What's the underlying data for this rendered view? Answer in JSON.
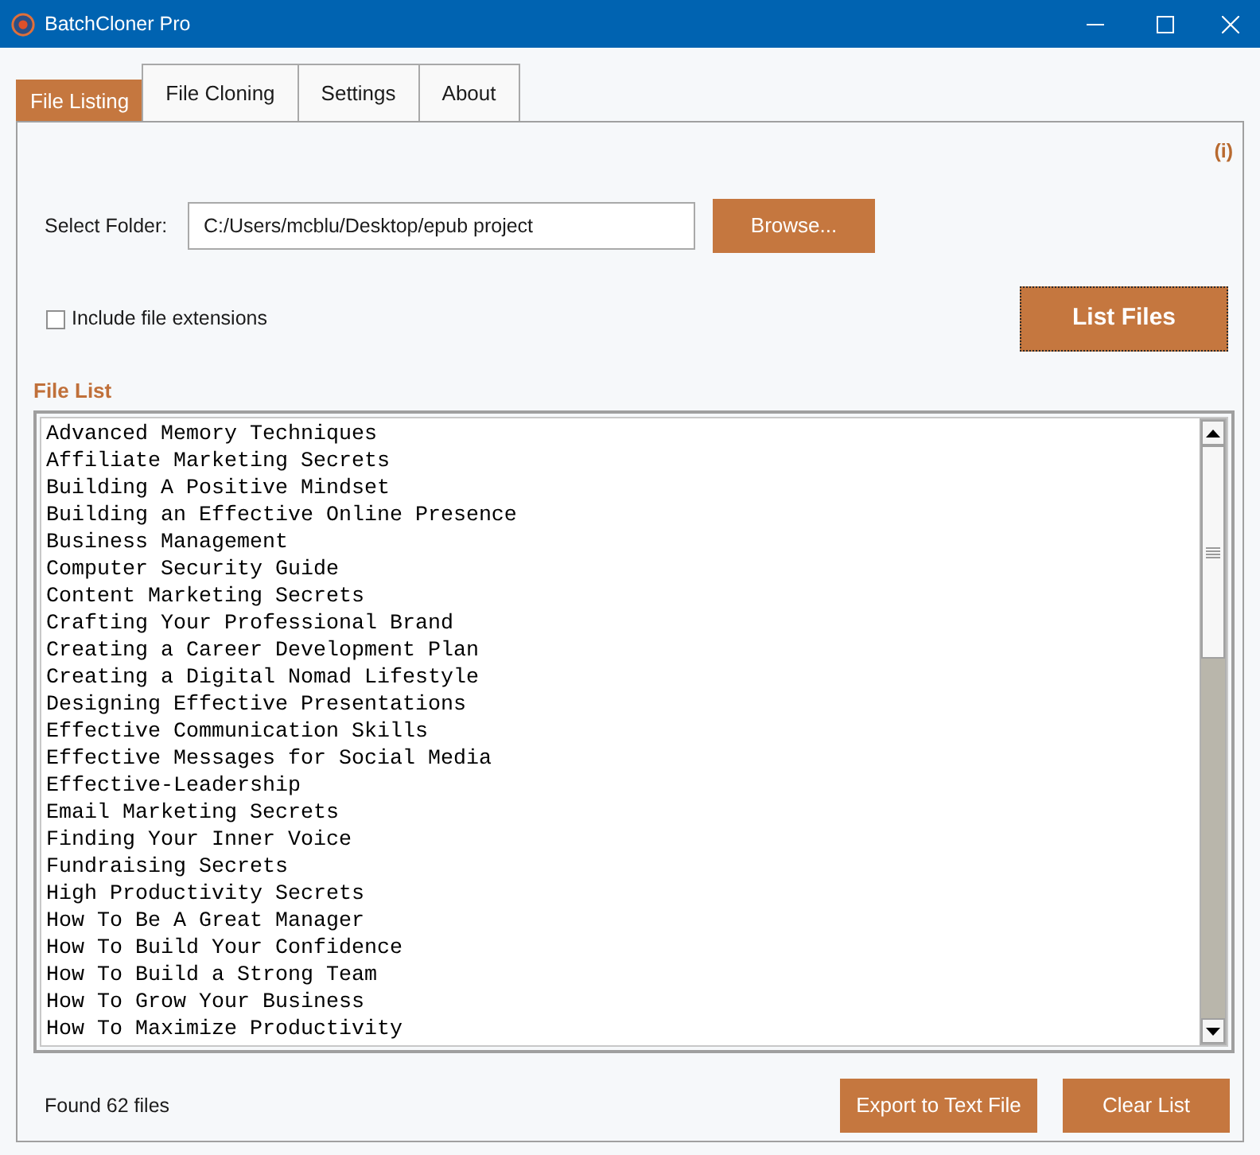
{
  "window": {
    "title": "BatchCloner Pro"
  },
  "tabs": [
    {
      "label": "File Listing",
      "selected": true
    },
    {
      "label": "File Cloning",
      "selected": false
    },
    {
      "label": "Settings",
      "selected": false
    },
    {
      "label": "About",
      "selected": false
    }
  ],
  "info_link": "(i)",
  "folder": {
    "label": "Select Folder:",
    "value": "C:/Users/mcblu/Desktop/epub project",
    "browse_button": "Browse..."
  },
  "include_extensions": {
    "label": "Include file extensions",
    "checked": false
  },
  "list_files_button": {
    "label": "List Files",
    "focused": true
  },
  "file_list": {
    "title": "File List",
    "items": [
      "Advanced Memory Techniques",
      "Affiliate Marketing Secrets",
      "Building A Positive Mindset",
      "Building an Effective Online Presence",
      "Business Management",
      "Computer Security Guide",
      "Content Marketing Secrets",
      "Crafting Your Professional Brand",
      "Creating a Career Development Plan",
      "Creating a Digital Nomad Lifestyle",
      "Designing Effective Presentations",
      "Effective Communication Skills",
      "Effective Messages for Social Media",
      "Effective-Leadership",
      "Email Marketing Secrets",
      "Finding Your Inner Voice",
      "Fundraising Secrets",
      "High Productivity Secrets",
      "How To Be A Great Manager",
      "How To Build Your Confidence",
      "How To Build a Strong Team",
      "How To Grow Your Business",
      "How To Maximize Productivity"
    ]
  },
  "status": "Found 62 files",
  "buttons": [
    "Export to Text File",
    "Clear List"
  ]
}
